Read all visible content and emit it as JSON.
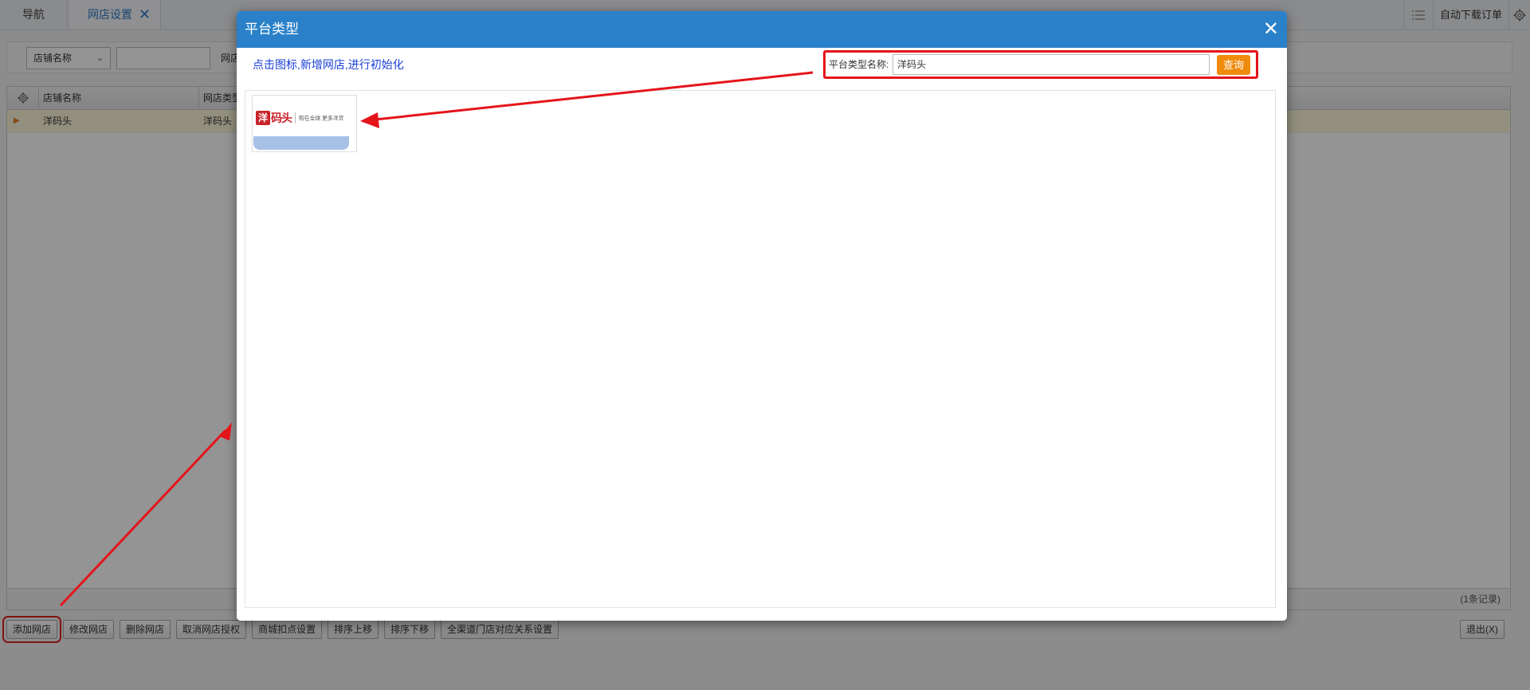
{
  "tabs": {
    "nav": "导航",
    "shop_settings": "网店设置",
    "close_glyph": "✕"
  },
  "toolbar_right": {
    "auto_download": "自动下载订单"
  },
  "filter": {
    "field_select": "店铺名称",
    "search_value": "",
    "label2": "网店"
  },
  "grid": {
    "columns": [
      "店铺名称",
      "网店类型"
    ],
    "rows": [
      {
        "marker": "▶",
        "name": "洋码头",
        "type": "洋码头"
      }
    ],
    "record_count": "(1条记录)"
  },
  "buttons": {
    "add": "添加网店",
    "edit": "修改网店",
    "delete": "删除网店",
    "cancel_auth": "取消网店授权",
    "mall_deduct": "商城扣点设置",
    "move_up": "排序上移",
    "move_down": "排序下移",
    "channel_map": "全渠道门店对应关系设置",
    "exit": "退出(X)"
  },
  "dialog": {
    "title": "平台类型",
    "close_glyph": "✕",
    "hint": "点击图标,新增网店,进行初始化",
    "search_label": "平台类型名称:",
    "search_value": "洋码头",
    "search_button": "查询",
    "platform_tile": {
      "bag_char": "洋",
      "brand": "码头",
      "slogan": "购在全球 更多洋货"
    }
  },
  "colors": {
    "dialog_header": "#2a81c9",
    "query_button": "#f08a0c",
    "highlight_red": "#e4141b",
    "hint_text": "#1a3fd6"
  }
}
